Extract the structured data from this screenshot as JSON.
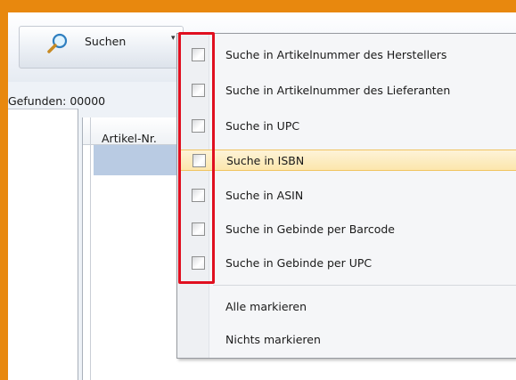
{
  "toolbar": {
    "search_label": "Suchen"
  },
  "status": {
    "found": "Gefunden: 00000"
  },
  "grid": {
    "columns": [
      "Artikel-Nr."
    ]
  },
  "menu": {
    "options": [
      {
        "label": "Suche in Artikelnummer des Herstellers",
        "checked": false
      },
      {
        "label": "Suche in Artikelnummer des Lieferanten",
        "checked": false
      },
      {
        "label": "Suche in UPC",
        "checked": false
      },
      {
        "label": "Suche in ISBN",
        "checked": false
      },
      {
        "label": "Suche in ASIN",
        "checked": false
      },
      {
        "label": "Suche in Gebinde per Barcode",
        "checked": false
      },
      {
        "label": "Suche in Gebinde per UPC",
        "checked": false
      }
    ],
    "actions": [
      {
        "label": "Alle markieren"
      },
      {
        "label": "Nichts markieren"
      }
    ],
    "highlighted": "Suche in ISBN"
  },
  "colors": {
    "accent_frame": "#e8880e",
    "annotation": "#e00f1f",
    "hover": "#fce6ac",
    "selection": "#b9cbe3"
  }
}
